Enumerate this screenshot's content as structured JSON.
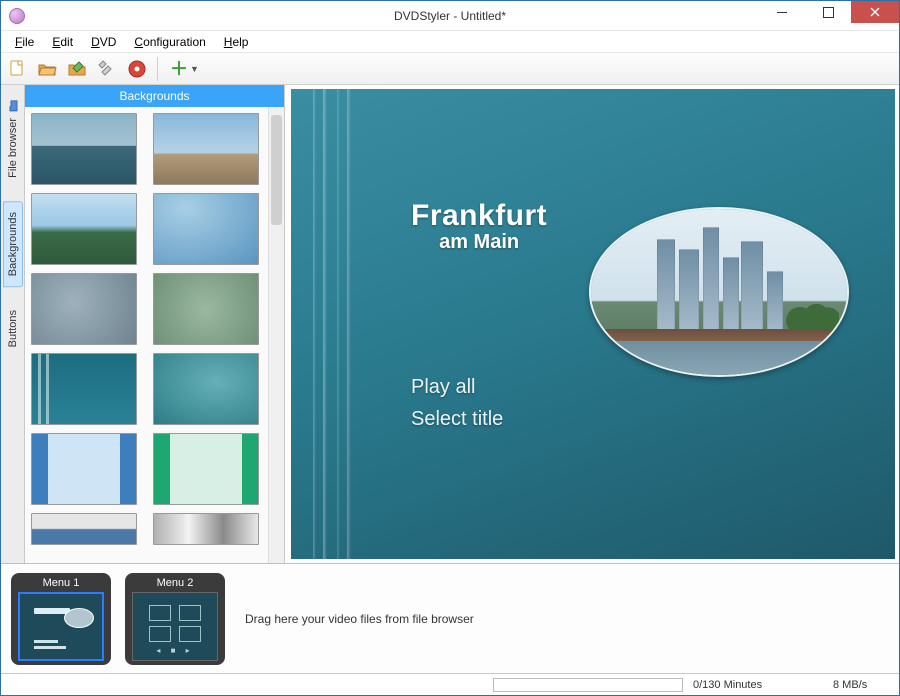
{
  "window": {
    "title": "DVDStyler - Untitled*"
  },
  "menubar": {
    "file": "File",
    "edit": "Edit",
    "dvd": "DVD",
    "configuration": "Configuration",
    "help": "Help"
  },
  "sidetabs": {
    "file_browser": "File browser",
    "backgrounds": "Backgrounds",
    "buttons": "Buttons"
  },
  "left_panel": {
    "header": "Backgrounds"
  },
  "preview": {
    "title_line1": "Frankfurt",
    "title_line2": "am Main",
    "menu_items": [
      "Play all",
      "Select title"
    ]
  },
  "timeline": {
    "menu1": "Menu 1",
    "menu2": "Menu 2",
    "drop_hint": "Drag here your video files from file browser"
  },
  "status": {
    "duration": "0/130 Minutes",
    "rate": "8 MB/s"
  }
}
